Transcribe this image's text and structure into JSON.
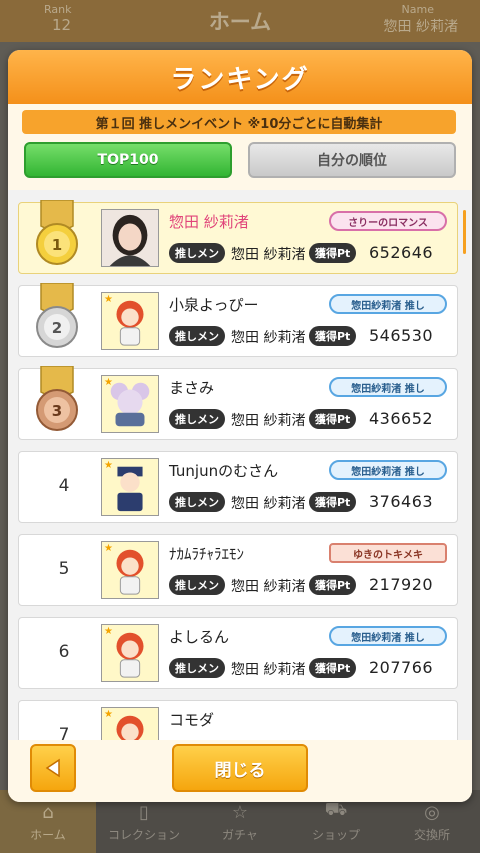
{
  "background": {
    "rank_label": "Rank",
    "rank_value": "12",
    "title": "ホーム",
    "name_label": "Name",
    "name_value": "惣田 紗莉渚",
    "nav": [
      {
        "label": "ホーム",
        "icon": "home-icon"
      },
      {
        "label": "コレクション",
        "icon": "collection-icon"
      },
      {
        "label": "ガチャ",
        "icon": "gacha-icon"
      },
      {
        "label": "ショップ",
        "icon": "cart-icon"
      },
      {
        "label": "交換所",
        "icon": "exchange-icon"
      }
    ]
  },
  "modal": {
    "title": "ランキング",
    "event_banner": "第１回 推しメンイベント ※10分ごとに自動集計",
    "tabs": {
      "top100": "TOP100",
      "my_rank": "自分の順位"
    },
    "close_label": "閉じる",
    "back_icon": "triangle-left-icon"
  },
  "ranking": {
    "oshi_label": "推しメン",
    "pt_label": "獲得Pt",
    "rows": [
      {
        "rank": "1",
        "name": "惣田 紗莉渚",
        "oshi": "惣田 紗莉渚",
        "points": "652646",
        "badge": "さりーのロマンス",
        "medal": "gold"
      },
      {
        "rank": "2",
        "name": "小泉よっぴー",
        "oshi": "惣田 紗莉渚",
        "points": "546530",
        "badge": "惣田紗莉渚 推し",
        "medal": "silver"
      },
      {
        "rank": "3",
        "name": "まさみ",
        "oshi": "惣田 紗莉渚",
        "points": "436652",
        "badge": "惣田紗莉渚 推し",
        "medal": "bronze"
      },
      {
        "rank": "4",
        "name": "Tunjunのむさん",
        "oshi": "惣田 紗莉渚",
        "points": "376463",
        "badge": "惣田紗莉渚 推し"
      },
      {
        "rank": "5",
        "name": "ﾅｶﾑﾗﾁｬﾗｴﾓﾝ",
        "oshi": "惣田 紗莉渚",
        "points": "217920",
        "badge": "ゆきのトキメキ"
      },
      {
        "rank": "6",
        "name": "よしるん",
        "oshi": "惣田 紗莉渚",
        "points": "207766",
        "badge": "惣田紗莉渚 推し"
      },
      {
        "rank": "7",
        "name": "コモダ",
        "oshi": "",
        "points": "",
        "badge": ""
      }
    ]
  },
  "colors": {
    "accent": "#f4901a",
    "name_highlight": "#e0447a",
    "tab_active": "#33b533"
  }
}
